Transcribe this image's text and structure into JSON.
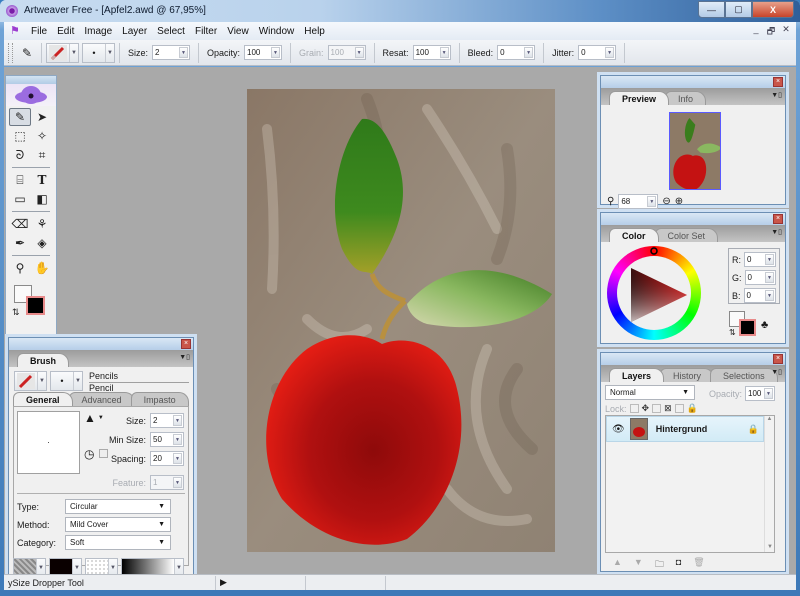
{
  "window": {
    "title": "Artweaver Free - [Apfel2.awd @ 67,95%]",
    "minimize": "—",
    "maximize": "▢",
    "close": "X"
  },
  "menu": {
    "items": [
      "File",
      "Edit",
      "Image",
      "Layer",
      "Select",
      "Filter",
      "View",
      "Window",
      "Help"
    ],
    "mdi_min": "_",
    "mdi_restore": "🗗",
    "mdi_close": "✕"
  },
  "toolbar": {
    "size_label": "Size:",
    "size_value": "2",
    "opacity_label": "Opacity:",
    "opacity_value": "100",
    "grain_label": "Grain:",
    "grain_value": "100",
    "resat_label": "Resat:",
    "resat_value": "100",
    "bleed_label": "Bleed:",
    "bleed_value": "0",
    "jitter_label": "Jitter:",
    "jitter_value": "0"
  },
  "tools": [
    {
      "name": "brush-tool",
      "glyph": "✎",
      "selected": true
    },
    {
      "name": "move-tool",
      "glyph": "➤"
    },
    {
      "name": "rect-select-tool",
      "glyph": "⬚"
    },
    {
      "name": "magic-wand-tool",
      "glyph": "✧"
    },
    {
      "name": "lasso-tool",
      "glyph": "ᘐ"
    },
    {
      "name": "crop-tool",
      "glyph": "⌗"
    },
    {
      "name": "gradient-mesh-tool",
      "glyph": "⌸"
    },
    {
      "name": "text-tool",
      "glyph": "T"
    },
    {
      "name": "rectangle-tool",
      "glyph": "▭"
    },
    {
      "name": "gradient-tool",
      "glyph": "◧"
    },
    {
      "name": "eraser-tool",
      "glyph": "⌫"
    },
    {
      "name": "clone-tool",
      "glyph": "⚘"
    },
    {
      "name": "dropper-tool",
      "glyph": "✒"
    },
    {
      "name": "fill-tool",
      "glyph": "◈"
    },
    {
      "name": "zoom-tool",
      "glyph": "⚲"
    },
    {
      "name": "hand-tool",
      "glyph": "✋"
    }
  ],
  "brush_panel": {
    "tab": "Brush",
    "category": "Pencils",
    "variant": "Pencil",
    "tabs": [
      "General",
      "Advanced",
      "Impasto"
    ],
    "size_label": "Size:",
    "size_value": "2",
    "minsize_label": "Min Size:",
    "minsize_value": "50",
    "spacing_label": "Spacing:",
    "spacing_value": "20",
    "feature_label": "Feature:",
    "feature_value": "1",
    "type_label": "Type:",
    "type_value": "Circular",
    "method_label": "Method:",
    "method_value": "Mild Cover",
    "category_label": "Category:",
    "category_value": "Soft"
  },
  "preview_panel": {
    "tabs": [
      "Preview",
      "Info"
    ],
    "zoom_value": "68"
  },
  "color_panel": {
    "tabs": [
      "Color",
      "Color Set"
    ],
    "r_label": "R:",
    "r_value": "0",
    "g_label": "G:",
    "g_value": "0",
    "b_label": "B:",
    "b_value": "0"
  },
  "layers_panel": {
    "tabs": [
      "Layers",
      "History",
      "Selections"
    ],
    "blend_mode": "Normal",
    "opacity_label": "Opacity:",
    "opacity_value": "100",
    "lock_label": "Lock:",
    "layers": [
      {
        "name": "Hintergrund",
        "visible": true,
        "locked": true
      }
    ]
  },
  "status": {
    "text": "ySize    Dropper Tool",
    "arrow": "▶"
  }
}
